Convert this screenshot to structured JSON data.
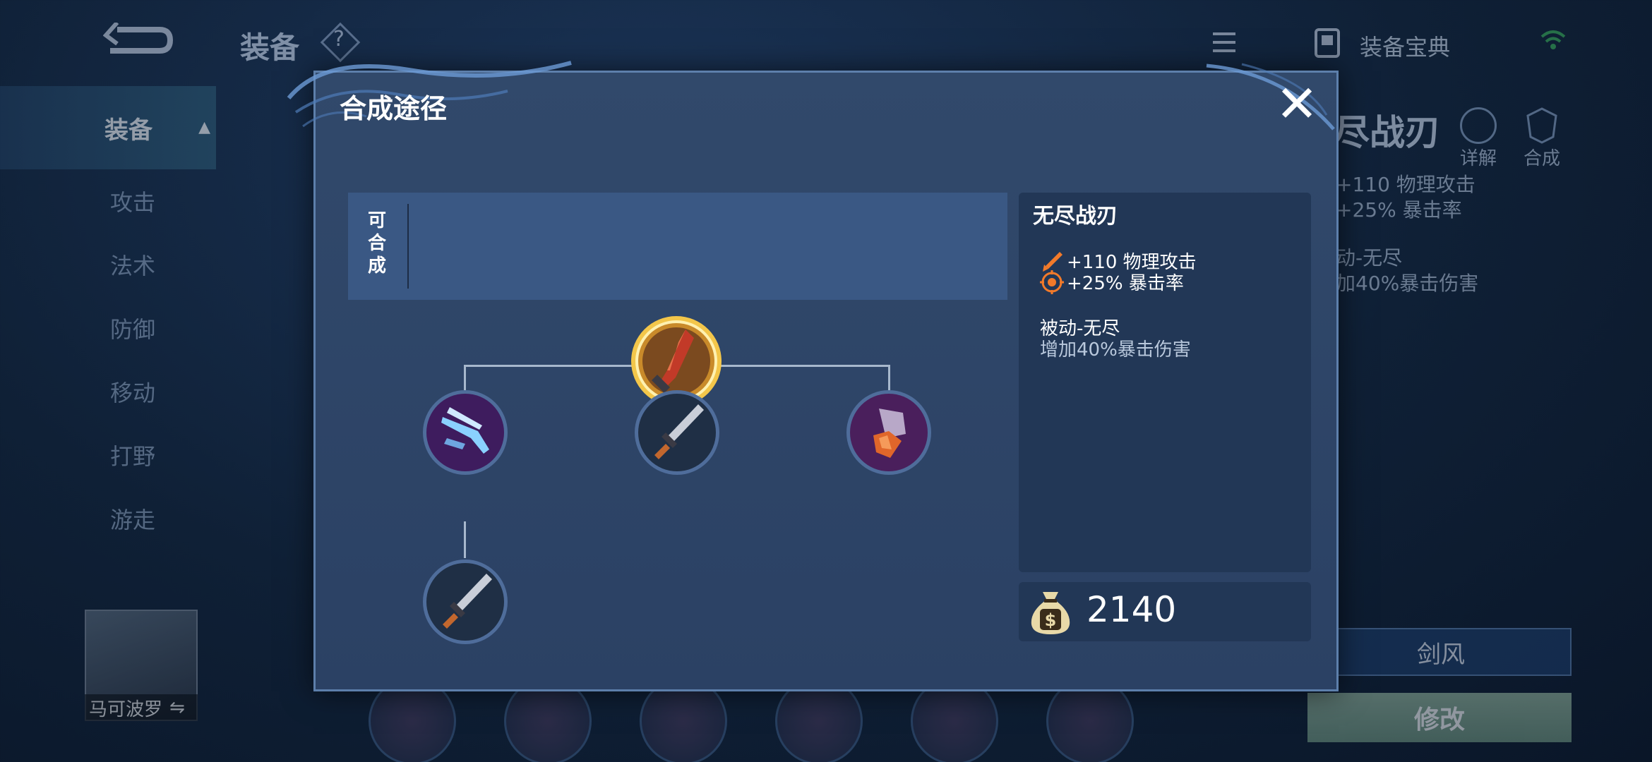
{
  "background": {
    "page_title": "装备",
    "help_glyph": "?",
    "codex_label": "装备宝典",
    "sidebar": {
      "active": "装备",
      "items": [
        "攻击",
        "法术",
        "防御",
        "移动",
        "打野",
        "游走"
      ]
    },
    "hero_name": "马可波罗",
    "swap_glyph": "⇋",
    "selected_item": {
      "title": "尽战刃",
      "detail_label": "详解",
      "synth_label": "合成",
      "stat1": "+110 物理攻击",
      "stat2": "+25% 暴击率",
      "passive_title": "动-无尽",
      "passive_desc": "加40%暴击伤害"
    },
    "sword_button": "剑风",
    "modify_button": "修改"
  },
  "modal": {
    "title": "合成途径",
    "close_glyph": "✕",
    "craftable_label": "可合成",
    "tree": {
      "root": {
        "icon": "infinity-blade-icon"
      },
      "children": [
        {
          "icon": "blue-storm-claw-icon",
          "children": [
            {
              "icon": "iron-sword-icon"
            }
          ]
        },
        {
          "icon": "iron-sword-icon"
        },
        {
          "icon": "purple-gauntlet-icon"
        }
      ]
    },
    "item_info": {
      "name": "无尽战刃",
      "stats": [
        {
          "icon": "physical-attack-icon",
          "text": "+110 物理攻击"
        },
        {
          "icon": "crit-rate-icon",
          "text": "+25% 暴击率"
        }
      ],
      "passive_title": "被动-无尽",
      "passive_desc": "增加40%暴击伤害"
    },
    "price": "2140",
    "coin_glyph": "$"
  },
  "colors": {
    "modal_bg": "#2b4164",
    "panel_bg": "#223756",
    "craftable_bg": "#3a5884",
    "stat_icon": "#f27a2a",
    "gold_ring": "#f3c64a"
  }
}
